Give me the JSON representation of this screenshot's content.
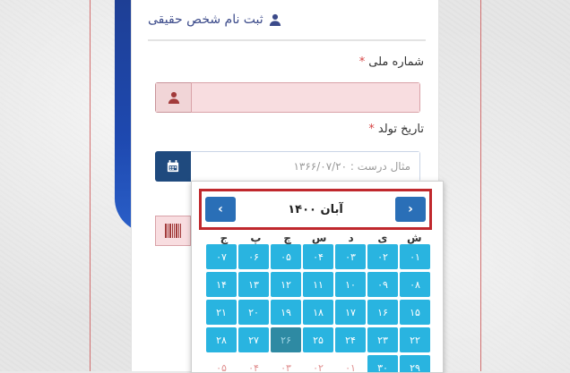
{
  "header": {
    "title": "ثبت نام شخص حقیقی",
    "icon": "user-icon"
  },
  "fields": {
    "national_id": {
      "label": "شماره ملی",
      "required_mark": "*",
      "value": "",
      "placeholder": "",
      "icon": "user-icon"
    },
    "birth_date": {
      "label": "تاریخ تولد",
      "required_mark": "*",
      "value": "",
      "placeholder": "مثال درست : ۱۳۶۶/۰۷/۲۰",
      "icon": "calendar-icon"
    }
  },
  "calendar": {
    "title": "آبان ۱۴۰۰",
    "prev_label": "‹",
    "next_label": "›",
    "weekdays": [
      "ش",
      "ی",
      "د",
      "س",
      "چ",
      "پ",
      "ج"
    ],
    "days": [
      {
        "label": "۰۱",
        "state": "normal"
      },
      {
        "label": "۰۲",
        "state": "normal"
      },
      {
        "label": "۰۳",
        "state": "normal"
      },
      {
        "label": "۰۴",
        "state": "normal"
      },
      {
        "label": "۰۵",
        "state": "normal"
      },
      {
        "label": "۰۶",
        "state": "normal"
      },
      {
        "label": "۰۷",
        "state": "normal"
      },
      {
        "label": "۰۸",
        "state": "normal"
      },
      {
        "label": "۰۹",
        "state": "normal"
      },
      {
        "label": "۱۰",
        "state": "normal"
      },
      {
        "label": "۱۱",
        "state": "normal"
      },
      {
        "label": "۱۲",
        "state": "normal"
      },
      {
        "label": "۱۳",
        "state": "normal"
      },
      {
        "label": "۱۴",
        "state": "normal"
      },
      {
        "label": "۱۵",
        "state": "normal"
      },
      {
        "label": "۱۶",
        "state": "normal"
      },
      {
        "label": "۱۷",
        "state": "normal"
      },
      {
        "label": "۱۸",
        "state": "normal"
      },
      {
        "label": "۱۹",
        "state": "normal"
      },
      {
        "label": "۲۰",
        "state": "normal"
      },
      {
        "label": "۲۱",
        "state": "normal"
      },
      {
        "label": "۲۲",
        "state": "normal"
      },
      {
        "label": "۲۳",
        "state": "normal"
      },
      {
        "label": "۲۴",
        "state": "normal"
      },
      {
        "label": "۲۵",
        "state": "normal"
      },
      {
        "label": "۲۶",
        "state": "today"
      },
      {
        "label": "۲۷",
        "state": "normal"
      },
      {
        "label": "۲۸",
        "state": "normal"
      },
      {
        "label": "۲۹",
        "state": "normal"
      },
      {
        "label": "۳۰",
        "state": "normal"
      },
      {
        "label": "۰۱",
        "state": "other"
      },
      {
        "label": "۰۲",
        "state": "other"
      },
      {
        "label": "۰۳",
        "state": "other"
      },
      {
        "label": "۰۴",
        "state": "other"
      },
      {
        "label": "۰۵",
        "state": "other"
      }
    ]
  },
  "colors": {
    "accent": "#29b4e0",
    "nav": "#2a6fb7",
    "highlight_border": "#c0282d",
    "brand": "#1f4a7e"
  }
}
